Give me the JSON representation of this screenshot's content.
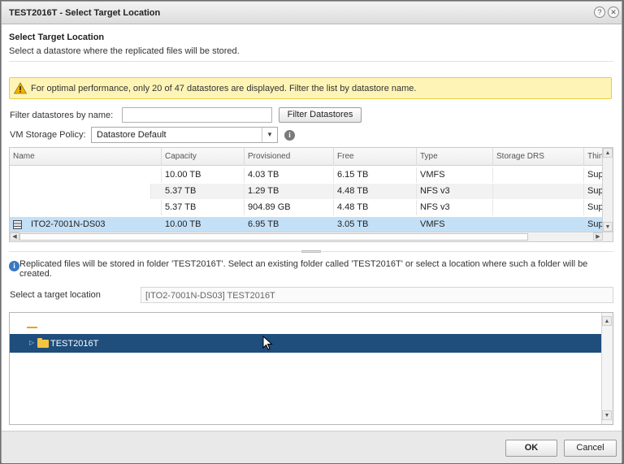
{
  "window": {
    "title": "TEST2016T - Select Target Location",
    "help_glyph": "?",
    "close_glyph": "✕"
  },
  "header": {
    "title": "Select Target Location",
    "subtitle": "Select a datastore where the replicated files will be stored."
  },
  "warning": {
    "text": "For optimal performance, only 20 of 47 datastores are displayed. Filter the list by datastore name.",
    "icon": "warning-icon"
  },
  "filter": {
    "label": "Filter datastores by name:",
    "value": "",
    "button_label": "Filter Datastores"
  },
  "policy": {
    "label": "VM Storage Policy:",
    "selected": "Datastore Default",
    "arrow": "▼",
    "info_glyph": "i"
  },
  "grid": {
    "columns": [
      "Name",
      "Capacity",
      "Provisioned",
      "Free",
      "Type",
      "Storage DRS",
      "Thin"
    ],
    "rows": [
      {
        "name": "",
        "capacity": "10.00 TB",
        "provisioned": "4.03 TB",
        "free": "6.15 TB",
        "type": "VMFS",
        "drs": "",
        "thin": "Sup"
      },
      {
        "name": "",
        "capacity": "5.37 TB",
        "provisioned": "1.29 TB",
        "free": "4.48 TB",
        "type": "NFS v3",
        "drs": "",
        "thin": "Sup"
      },
      {
        "name": "",
        "capacity": "5.37 TB",
        "provisioned": "904.89 GB",
        "free": "4.48 TB",
        "type": "NFS v3",
        "drs": "",
        "thin": "Sup"
      },
      {
        "name": "ITO2-7001N-DS03",
        "capacity": "10.00 TB",
        "provisioned": "6.95 TB",
        "free": "3.05 TB",
        "type": "VMFS",
        "drs": "",
        "thin": "Sup"
      }
    ],
    "selected_index": 3
  },
  "note": {
    "text": "Replicated files will be stored in folder 'TEST2016T'. Select an existing folder called 'TEST2016T' or select a location where such a folder will be created."
  },
  "target": {
    "label": "Select a target location",
    "value": "[ITO2-7001N-DS03] TEST2016T"
  },
  "tree": {
    "items": [
      {
        "label": "TEST2016T",
        "expander": "▷",
        "selected": true
      }
    ]
  },
  "footer": {
    "ok_label": "OK",
    "cancel_label": "Cancel"
  },
  "colors": {
    "selection_row": "#c4e0f7",
    "tree_selection": "#1f4d7c",
    "warning_bg": "#fdf4b6",
    "folder": "#f3c441"
  }
}
